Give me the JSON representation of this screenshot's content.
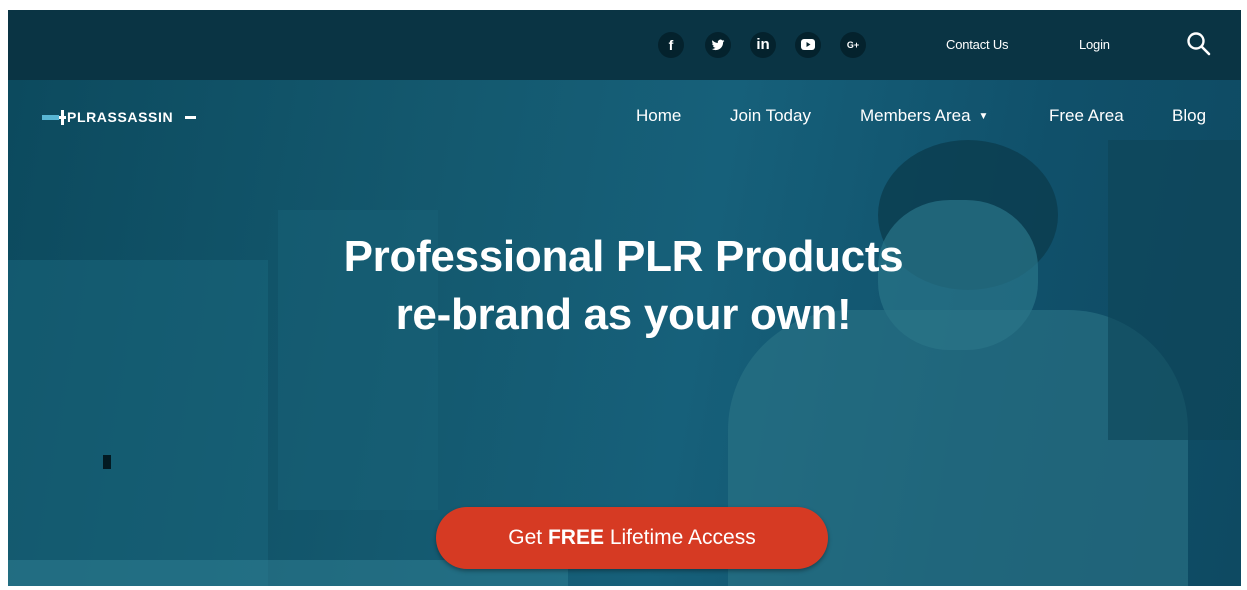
{
  "topbar": {
    "social": [
      {
        "name": "facebook",
        "glyph": "f"
      },
      {
        "name": "twitter",
        "glyph": "𝕥"
      },
      {
        "name": "linkedin",
        "glyph": "in"
      },
      {
        "name": "youtube",
        "glyph": "▶"
      },
      {
        "name": "google-plus",
        "glyph": "G+"
      }
    ],
    "contact_label": "Contact Us",
    "login_label": "Login"
  },
  "logo": {
    "text": "PLRASSASSIN"
  },
  "nav": {
    "home": "Home",
    "join": "Join Today",
    "members": "Members Area",
    "free": "Free Area",
    "blog": "Blog"
  },
  "hero": {
    "line1": "Professional PLR Products",
    "line2": "re-brand as your own!",
    "cta_prefix": "Get ",
    "cta_bold": "FREE",
    "cta_suffix": " Lifetime Access"
  },
  "colors": {
    "topbar": "#0a3444",
    "hero_overlay": "#14596f",
    "cta": "#d63a23"
  }
}
